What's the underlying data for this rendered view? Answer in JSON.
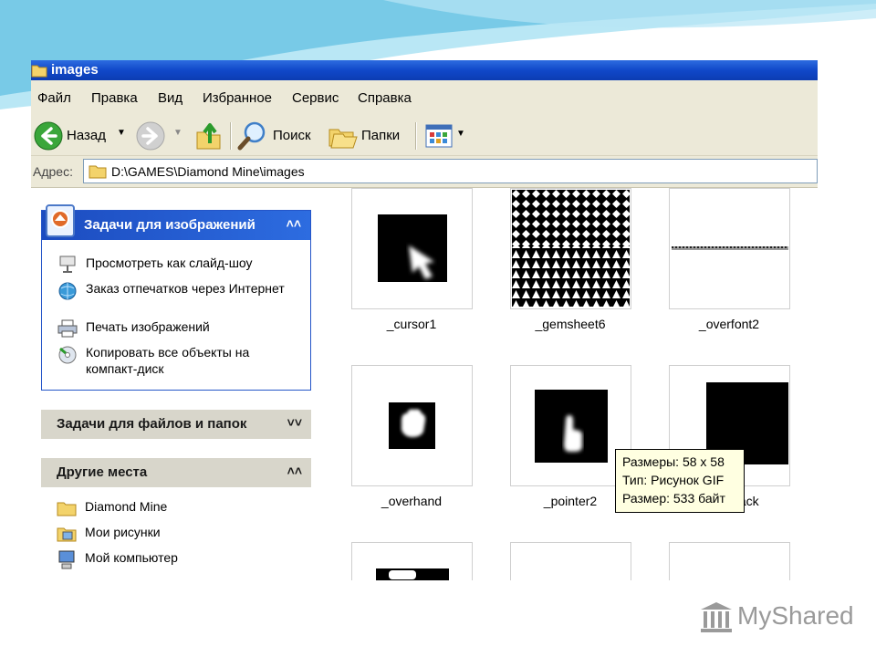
{
  "window": {
    "title": "images"
  },
  "menu": {
    "items": [
      "Файл",
      "Правка",
      "Вид",
      "Избранное",
      "Сервис",
      "Справка"
    ]
  },
  "toolbar": {
    "back": "Назад",
    "search": "Поиск",
    "folders": "Папки"
  },
  "address": {
    "label": "Адрес:",
    "path": "D:\\GAMES\\Diamond Mine\\images"
  },
  "sidebar": {
    "image_tasks": {
      "title": "Задачи для изображений",
      "items": [
        {
          "label": "Просмотреть как слайд-шоу",
          "icon": "slideshow-icon"
        },
        {
          "label": "Заказ отпечатков через Интернет",
          "icon": "order-prints-icon"
        },
        {
          "label": "Печать изображений",
          "icon": "print-icon"
        },
        {
          "label": "Копировать все объекты на компакт-диск",
          "icon": "burn-cd-icon"
        }
      ]
    },
    "file_tasks": {
      "title": "Задачи для файлов и папок"
    },
    "other_places": {
      "title": "Другие места",
      "items": [
        {
          "label": "Diamond Mine",
          "icon": "folder-icon"
        },
        {
          "label": "Мои рисунки",
          "icon": "my-pictures-icon"
        },
        {
          "label": "Мой компьютер",
          "icon": "my-computer-icon"
        }
      ]
    }
  },
  "files": [
    {
      "name": "_cursor1"
    },
    {
      "name": "_gemsheet6"
    },
    {
      "name": "_overfont2"
    },
    {
      "name": "_overhand"
    },
    {
      "name": "_pointer2"
    },
    {
      "name": "_real-back"
    }
  ],
  "tooltip": {
    "line1": "Размеры: 58 x 58",
    "line2": "Тип: Рисунок GIF",
    "line3": "Размер: 533 байт"
  },
  "watermark": {
    "text": "MyShared"
  },
  "colors": {
    "titlebar": "#0c3db2",
    "task_panel_header": "#1c4cc0",
    "chrome": "#ece9d8"
  }
}
